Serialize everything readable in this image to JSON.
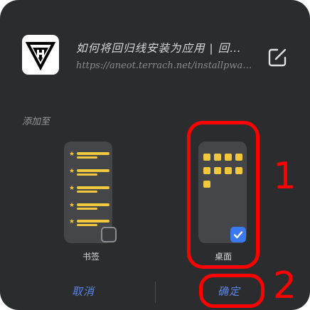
{
  "page": {
    "title": "如何将回归线安装为应用 | 回…",
    "url": "https://aneot.terrach.net/installpwa…",
    "section_label": "添加至"
  },
  "options": [
    {
      "label": "书签",
      "checked": false
    },
    {
      "label": "桌面",
      "checked": true
    }
  ],
  "buttons": {
    "cancel": "取消",
    "confirm": "确定"
  },
  "annotations": [
    "1",
    "2"
  ],
  "icons": {
    "app": "app-logo-icon",
    "edit": "edit-icon",
    "star": "star-icon",
    "check": "checkmark-icon"
  },
  "colors": {
    "dialog_bg": "#2b2c2e",
    "card_bg": "#45464a",
    "accent_yellow": "#f1c83c",
    "accent_blue": "#3a79f0",
    "link_blue": "#5b86e6",
    "annotation_red": "#ff0000"
  }
}
